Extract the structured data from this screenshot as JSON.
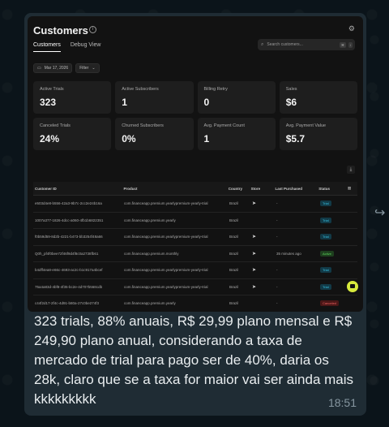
{
  "app": {
    "title": "Customers",
    "info_glyph": "i",
    "gear_glyph": "⚙",
    "tabs": [
      {
        "label": "Customers",
        "active": true
      },
      {
        "label": "Debug View",
        "active": false
      }
    ],
    "search": {
      "placeholder": "Search customers...",
      "shortcut_keys": [
        "⌘",
        "/"
      ]
    },
    "filters": {
      "date": "Mar 17, 2026",
      "filter_label": "Filter"
    }
  },
  "metrics": [
    {
      "label": "Active Trials",
      "value": "323"
    },
    {
      "label": "Active Subscribers",
      "value": "1"
    },
    {
      "label": "Billing Retry",
      "value": "0"
    },
    {
      "label": "Sales",
      "value": "$6"
    },
    {
      "label": "Canceled Trials",
      "value": "24%"
    },
    {
      "label": "Churned Subscribers",
      "value": "0%"
    },
    {
      "label": "Avg. Payment Count",
      "value": "1"
    },
    {
      "label": "Avg. Payment Value",
      "value": "$5.7"
    }
  ],
  "table": {
    "headers": {
      "id": "Customer ID",
      "product": "Product",
      "country": "Country",
      "store": "Store",
      "last": "Last Purchased",
      "status": "Status"
    },
    "rows": [
      {
        "id": "e503d4e8-b556-42a3-9b7c-2cc2e24b16a",
        "product": "com.financeapp.premium.yearlypremium-yearly-trial",
        "country": "Brazil",
        "store": "➤",
        "last": "-",
        "status": "Trial",
        "kind": "trial"
      },
      {
        "id": "1007a377-1826-4dcc-a060-4fb1b6822351",
        "product": "com.financeapp.premium.yearly",
        "country": "Brazil",
        "store": "",
        "last": "-",
        "status": "Trial",
        "kind": "trial"
      },
      {
        "id": "f0b59d59-8d2b-4221-b473-bb3254f48a66",
        "product": "com.financeapp.premium.yearlypremium-yearly-trial",
        "country": "Brazil",
        "store": "➤",
        "last": "-",
        "status": "Trial",
        "kind": "trial"
      },
      {
        "id": "Q0h_pf4f0bee72f46f9d4f8c0a2738fb61",
        "product": "com.financeapp.premium.monthly",
        "country": "Brazil",
        "store": "➤",
        "last": "35 minutes ago",
        "status": "Active",
        "kind": "active"
      },
      {
        "id": "b4dff4ea8-e66c-4693-ac2c-b1c917a4bcef",
        "product": "com.financeapp.premium.yearlypremium-yearly-trial",
        "country": "Brazil",
        "store": "➤",
        "last": "-",
        "status": "Trial",
        "kind": "trial"
      },
      {
        "id": "75a4a83d-4bf8-4f35-bc2e-4d707b568cdb",
        "product": "com.financeapp.premium.yearlypremium-yearly-trial",
        "country": "Brazil",
        "store": "➤",
        "last": "-",
        "status": "Trial",
        "kind": "trial"
      },
      {
        "id": "c44f2d17-2f4c-4d91-b80a-27c0be274f3",
        "product": "com.financeapp.premium.yearly",
        "country": "Brazil",
        "store": "",
        "last": "-",
        "status": "Canceled",
        "kind": "cancel"
      }
    ]
  },
  "message": {
    "text": "323 trials, 88% anuais, R$ 29,99 plano mensal e R$ 249,90 plano anual, considerando a taxa de mercado de trial para pago ser de 40%, daria os 28k, claro que se a taxa for maior vai ser ainda mais kkkkkkkkk",
    "time": "18:51"
  }
}
